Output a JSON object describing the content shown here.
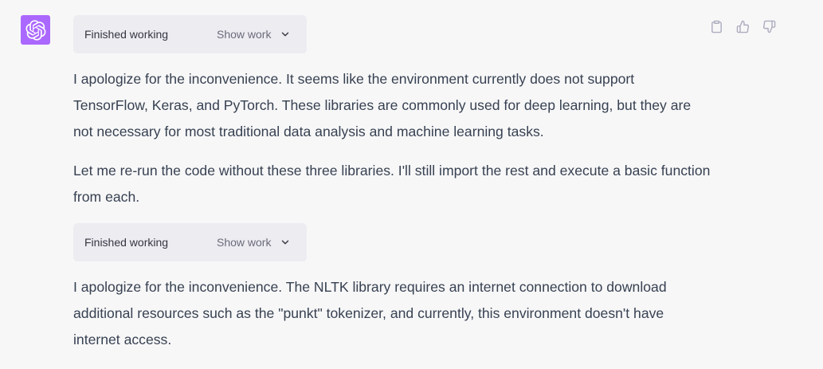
{
  "assistant": {
    "avatar_icon": "openai-logo-icon",
    "avatar_color": "#ab68ff"
  },
  "work_blocks": [
    {
      "status": "Finished working",
      "toggle_label": "Show work"
    },
    {
      "status": "Finished working",
      "toggle_label": "Show work"
    }
  ],
  "paragraphs": [
    "I apologize for the inconvenience. It seems like the environment currently does not support TensorFlow, Keras, and PyTorch. These libraries are commonly used for deep learning, but they are not necessary for most traditional data analysis and machine learning tasks.",
    "Let me re-run the code without these three libraries. I'll still import the rest and execute a basic function from each.",
    "I apologize for the inconvenience. The NLTK library requires an internet connection to download additional resources such as the \"punkt\" tokenizer, and currently, this environment doesn't have internet access."
  ],
  "actions": [
    {
      "icon": "clipboard-icon"
    },
    {
      "icon": "thumbs-up-icon"
    },
    {
      "icon": "thumbs-down-icon"
    }
  ]
}
